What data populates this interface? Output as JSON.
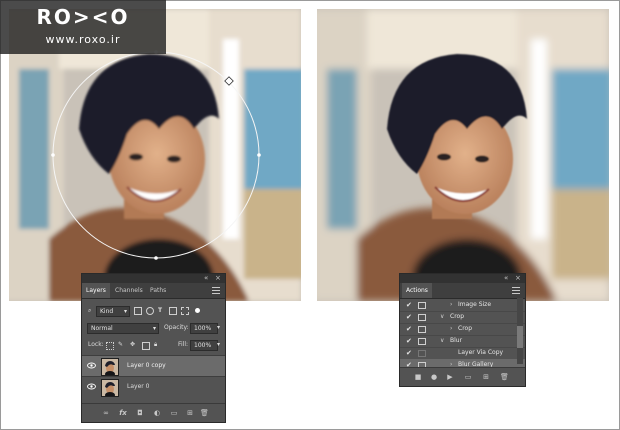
{
  "watermark": {
    "logo": "RO><O",
    "url": "www.roxo.ir"
  },
  "layers_panel": {
    "collapse": "«",
    "close": "×",
    "tabs": [
      {
        "label": "Layers",
        "active": true
      },
      {
        "label": "Channels",
        "active": false
      },
      {
        "label": "Paths",
        "active": false
      }
    ],
    "filter_value": "Kind",
    "blend_mode": "Normal",
    "opacity_label": "Opacity:",
    "opacity_value": "100%",
    "lock_label": "Lock:",
    "fill_label": "Fill:",
    "fill_value": "100%",
    "layers": [
      {
        "name": "Layer 0 copy",
        "selected": true
      },
      {
        "name": "Layer 0",
        "selected": false
      }
    ],
    "footer_icons": [
      "link-icon",
      "fx-icon",
      "mask-icon",
      "adjustment-icon",
      "group-folder-icon",
      "new-layer-icon",
      "trash-icon"
    ],
    "fx_label": "fx"
  },
  "actions_panel": {
    "collapse": "«",
    "close": "×",
    "title": "Actions",
    "items": [
      {
        "label": "Image Size",
        "indent": 2,
        "expanded": false,
        "check": "✔",
        "selected": false
      },
      {
        "label": "Crop",
        "indent": 1,
        "expanded": true,
        "check": "✔",
        "selected": false
      },
      {
        "label": "Crop",
        "indent": 2,
        "expanded": false,
        "check": "✔",
        "selected": false
      },
      {
        "label": "Blur",
        "indent": 1,
        "expanded": true,
        "check": "✔",
        "selected": false
      },
      {
        "label": "Layer Via Copy",
        "indent": 2,
        "expanded": false,
        "check": "✔",
        "selected": false
      },
      {
        "label": "Blur Gallery",
        "indent": 2,
        "expanded": false,
        "check": "✔",
        "selected": true
      }
    ],
    "footer_icons": [
      "stop-icon",
      "record-icon",
      "play-icon",
      "new-set-icon",
      "new-action-icon",
      "trash-icon"
    ]
  },
  "colors": {
    "panel_bg": "#535353",
    "panel_header": "#3f3f3f",
    "selection": "#6b6b6b",
    "text": "#dcdcdc"
  }
}
